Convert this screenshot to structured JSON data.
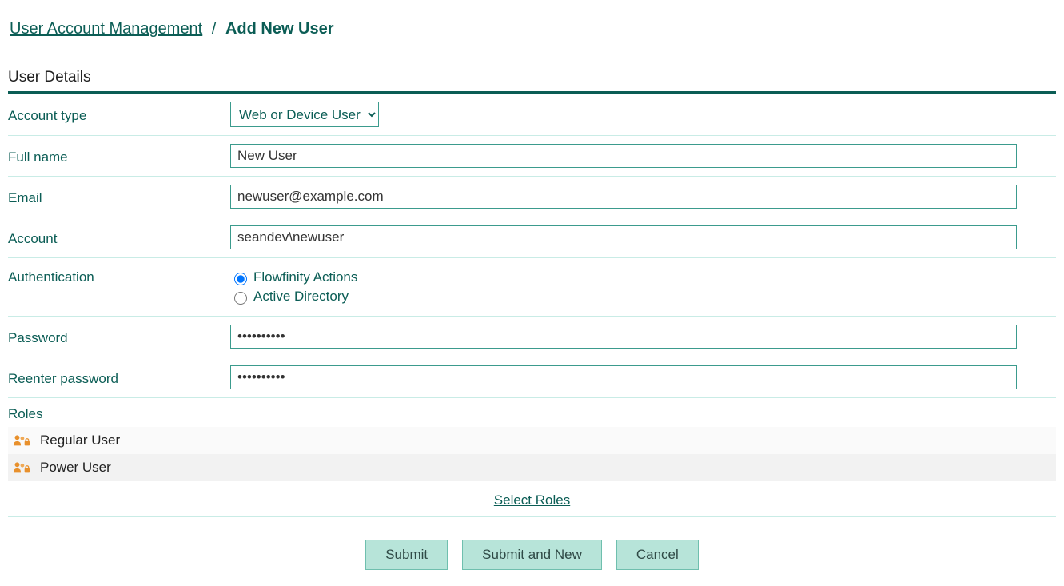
{
  "breadcrumb": {
    "root_label": "User Account Management",
    "separator": "/",
    "current_label": "Add New User"
  },
  "section_title": "User Details",
  "form": {
    "account_type": {
      "label": "Account type",
      "value": "Web or Device User"
    },
    "full_name": {
      "label": "Full name",
      "value": "New User"
    },
    "email": {
      "label": "Email",
      "value": "newuser@example.com"
    },
    "account": {
      "label": "Account",
      "value": "seandev\\newuser"
    },
    "authentication": {
      "label": "Authentication",
      "option1": "Flowfinity Actions",
      "option2": "Active Directory",
      "selected": "Flowfinity Actions"
    },
    "password": {
      "label": "Password",
      "value": "••••••••••"
    },
    "reenter_password": {
      "label": "Reenter password",
      "value": "••••••••••"
    }
  },
  "roles": {
    "label": "Roles",
    "items": [
      {
        "name": "Regular User"
      },
      {
        "name": "Power User"
      }
    ],
    "select_label": "Select Roles"
  },
  "buttons": {
    "submit": "Submit",
    "submit_and_new": "Submit and New",
    "cancel": "Cancel"
  },
  "colors": {
    "accent": "#0b5d55",
    "border": "#c9ece6",
    "button_bg": "#b7e4d9"
  }
}
